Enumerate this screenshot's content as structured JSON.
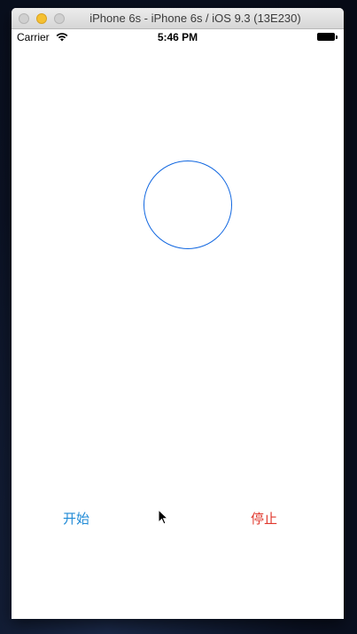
{
  "window": {
    "title": "iPhone 6s - iPhone 6s / iOS 9.3 (13E230)"
  },
  "status_bar": {
    "carrier": "Carrier",
    "time": "5:46 PM",
    "icons": [
      "wifi-icon",
      "battery-icon"
    ]
  },
  "main": {
    "circle_color": "#1167e0",
    "start_label": "开始",
    "stop_label": "停止",
    "start_color": "#1f8ad6",
    "stop_color": "#e0382d"
  }
}
